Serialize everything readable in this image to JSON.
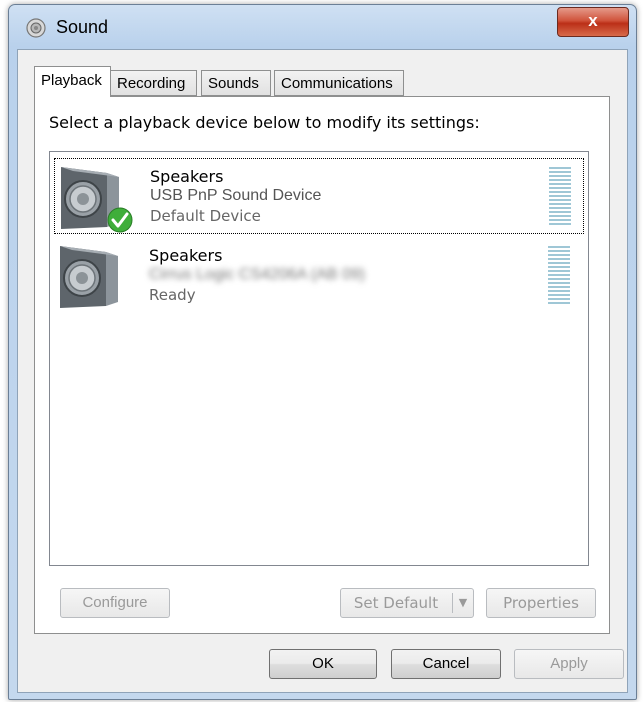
{
  "window": {
    "title": "Sound",
    "close_label": "x"
  },
  "tabs": [
    {
      "label": "Playback",
      "active": true
    },
    {
      "label": "Recording",
      "active": false
    },
    {
      "label": "Sounds",
      "active": false
    },
    {
      "label": "Communications",
      "active": false
    }
  ],
  "playback": {
    "instructions": "Select a playback device below to modify its settings:",
    "devices": [
      {
        "name": "Speakers",
        "description": "USB PnP Sound Device",
        "status": "Default Device",
        "icon": "speaker-icon",
        "default": true
      },
      {
        "name": "Speakers",
        "description": "Cirrus Logic CS4206A (AB 09)",
        "status": "Ready",
        "icon": "speaker-icon",
        "default": false
      }
    ],
    "buttons": {
      "configure": "Configure",
      "set_default": "Set Default",
      "properties": "Properties"
    }
  },
  "dialog_buttons": {
    "ok": "OK",
    "cancel": "Cancel",
    "apply": "Apply"
  },
  "colors": {
    "accent": "#3399ff",
    "close": "#c9452a",
    "level": "#9fc7d6",
    "check": "#3fae3a"
  }
}
